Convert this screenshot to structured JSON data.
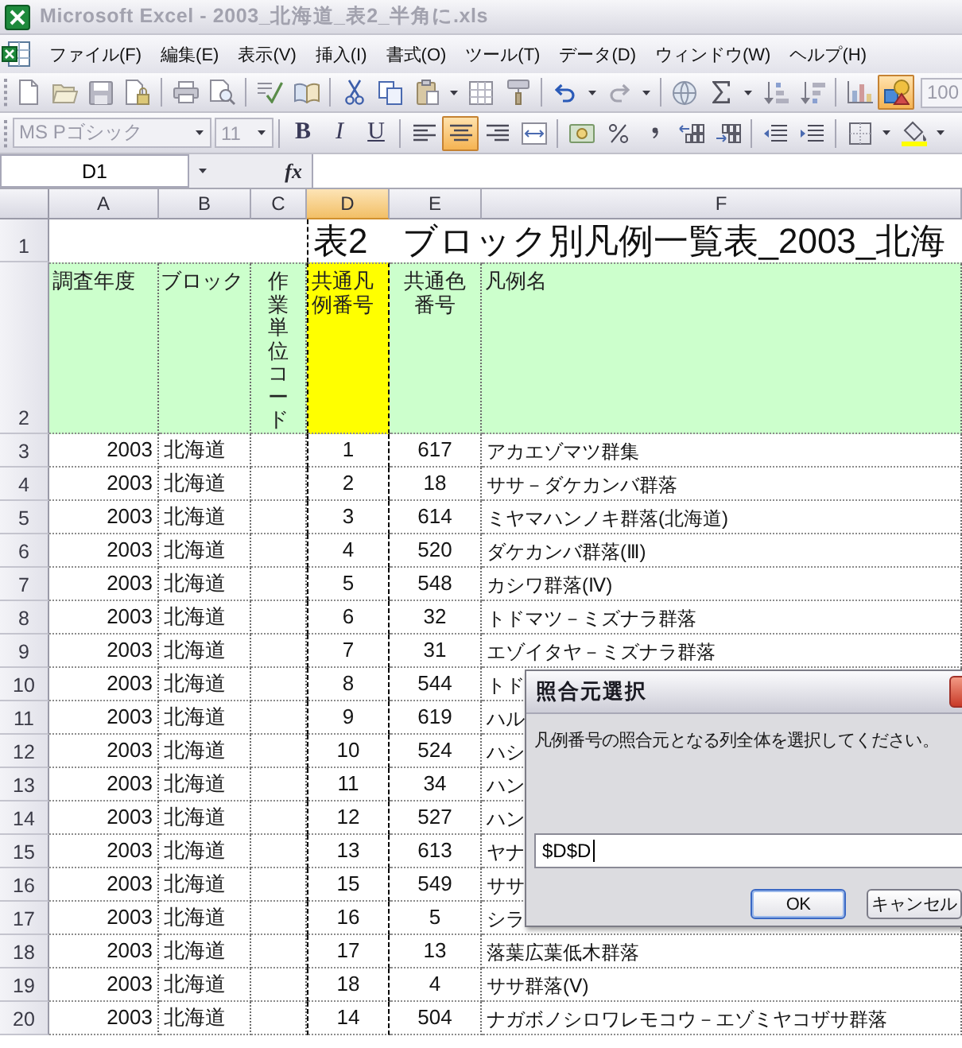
{
  "window": {
    "title": "Microsoft Excel - 2003_北海道_表2_半角に.xls",
    "active": false
  },
  "menu": [
    "ファイル(F)",
    "編集(E)",
    "表示(V)",
    "挿入(I)",
    "書式(O)",
    "ツール(T)",
    "データ(D)",
    "ウィンドウ(W)",
    "ヘルプ(H)"
  ],
  "standard_toolbar": {
    "drawing_on": true,
    "zoom": "100"
  },
  "formatting_toolbar": {
    "font": {
      "value": "MS Pゴシック",
      "disabled": true
    },
    "size": {
      "value": "11",
      "disabled": true
    },
    "styles": [
      {
        "kind": "bold",
        "label": "B",
        "on": false
      },
      {
        "kind": "italic",
        "label": "I",
        "on": false
      },
      {
        "kind": "underline",
        "label": "U",
        "on": false
      }
    ],
    "alignment": [
      {
        "kind": "left",
        "selected": false
      },
      {
        "kind": "center",
        "selected": true
      },
      {
        "kind": "right",
        "selected": false
      }
    ]
  },
  "formula_bar": {
    "name_box": "D1",
    "function_label": "fx"
  },
  "sheet": {
    "columns": [
      {
        "label": "A",
        "selected": false
      },
      {
        "label": "B",
        "selected": false
      },
      {
        "label": "C",
        "selected": false
      },
      {
        "label": "D",
        "selected": true
      },
      {
        "label": "E",
        "selected": false
      },
      {
        "label": "F",
        "selected": false
      }
    ],
    "rows": [
      {
        "number": "1",
        "kind": "title",
        "cells": {
          "D": "表2　ブロック別凡例一覧表_2003_北海"
        }
      },
      {
        "number": "2",
        "kind": "header",
        "cells": {
          "A": {
            "text": "調査年度",
            "color": "#ccffcc"
          },
          "B": {
            "text": "ブロック",
            "color": "#ccffcc"
          },
          "C": {
            "text": "作業単位コード",
            "color": "#ccffcc"
          },
          "D": {
            "text": "共通凡例番号",
            "color": "#ffff00"
          },
          "E": {
            "text": "共通色番号",
            "color": "#ccffcc"
          },
          "F": {
            "text": "凡例名",
            "color": "#ccffcc"
          }
        }
      },
      {
        "number": "3",
        "kind": "data",
        "cells": {
          "A": "2003",
          "B": "北海道",
          "D": "1",
          "E": "617",
          "F": "アカエゾマツ群集"
        }
      },
      {
        "number": "4",
        "kind": "data",
        "cells": {
          "A": "2003",
          "B": "北海道",
          "D": "2",
          "E": "18",
          "F": "ササ－ダケカンバ群落"
        }
      },
      {
        "number": "5",
        "kind": "data",
        "cells": {
          "A": "2003",
          "B": "北海道",
          "D": "3",
          "E": "614",
          "F": "ミヤマハンノキ群落(北海道)"
        }
      },
      {
        "number": "6",
        "kind": "data",
        "cells": {
          "A": "2003",
          "B": "北海道",
          "D": "4",
          "E": "520",
          "F": "ダケカンバ群落(Ⅲ)"
        }
      },
      {
        "number": "7",
        "kind": "data",
        "cells": {
          "A": "2003",
          "B": "北海道",
          "D": "5",
          "E": "548",
          "F": "カシワ群落(Ⅳ)"
        }
      },
      {
        "number": "8",
        "kind": "data",
        "cells": {
          "A": "2003",
          "B": "北海道",
          "D": "6",
          "E": "32",
          "F": "トドマツ－ミズナラ群落"
        }
      },
      {
        "number": "9",
        "kind": "data",
        "cells": {
          "A": "2003",
          "B": "北海道",
          "D": "7",
          "E": "31",
          "F": "エゾイタヤ－ミズナラ群落"
        }
      },
      {
        "number": "10",
        "kind": "data",
        "cells": {
          "A": "2003",
          "B": "北海道",
          "D": "8",
          "E": "544",
          "F": "トド"
        }
      },
      {
        "number": "11",
        "kind": "data",
        "cells": {
          "A": "2003",
          "B": "北海道",
          "D": "9",
          "E": "619",
          "F": "ハル"
        }
      },
      {
        "number": "12",
        "kind": "data",
        "cells": {
          "A": "2003",
          "B": "北海道",
          "D": "10",
          "E": "524",
          "F": "ハシ"
        }
      },
      {
        "number": "13",
        "kind": "data",
        "cells": {
          "A": "2003",
          "B": "北海道",
          "D": "11",
          "E": "34",
          "F": "ハン"
        }
      },
      {
        "number": "14",
        "kind": "data",
        "cells": {
          "A": "2003",
          "B": "北海道",
          "D": "12",
          "E": "527",
          "F": "ハン"
        }
      },
      {
        "number": "15",
        "kind": "data",
        "cells": {
          "A": "2003",
          "B": "北海道",
          "D": "13",
          "E": "613",
          "F": "ヤナ"
        }
      },
      {
        "number": "16",
        "kind": "data",
        "cells": {
          "A": "2003",
          "B": "北海道",
          "D": "15",
          "E": "549",
          "F": "ササ"
        }
      },
      {
        "number": "17",
        "kind": "data",
        "cells": {
          "A": "2003",
          "B": "北海道",
          "D": "16",
          "E": "5",
          "F": "シラ"
        }
      },
      {
        "number": "18",
        "kind": "data",
        "cells": {
          "A": "2003",
          "B": "北海道",
          "D": "17",
          "E": "13",
          "F": "落葉広葉低木群落"
        }
      },
      {
        "number": "19",
        "kind": "data",
        "cells": {
          "A": "2003",
          "B": "北海道",
          "D": "18",
          "E": "4",
          "F": "ササ群落(Ⅴ)"
        }
      },
      {
        "number": "20",
        "kind": "data",
        "cells": {
          "A": "2003",
          "B": "北海道",
          "D": "14",
          "E": "504",
          "F": "ナガボノシロワレモコウ－エゾミヤコザサ群落"
        }
      }
    ]
  },
  "dialog": {
    "title": "照合元選択",
    "message": "凡例番号の照合元となる列全体を選択してください。",
    "value": "$D$D",
    "buttons": [
      {
        "label": "OK",
        "default": true
      },
      {
        "label": "キャンセル",
        "default": false
      }
    ]
  }
}
